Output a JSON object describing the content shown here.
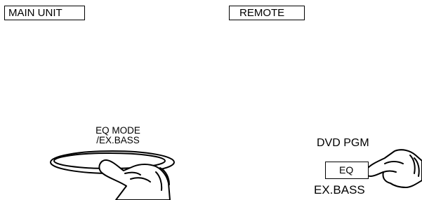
{
  "main_unit": {
    "section_label": "MAIN UNIT",
    "button_label_line1": "EQ MODE",
    "button_label_line2": "/EX.BASS"
  },
  "remote": {
    "section_label": "REMOTE",
    "label_above_key": "DVD PGM",
    "key_label": "EQ",
    "label_below_key": "EX.BASS"
  },
  "icons": [
    "pointing-hand-icon",
    "pointing-hand-icon"
  ]
}
